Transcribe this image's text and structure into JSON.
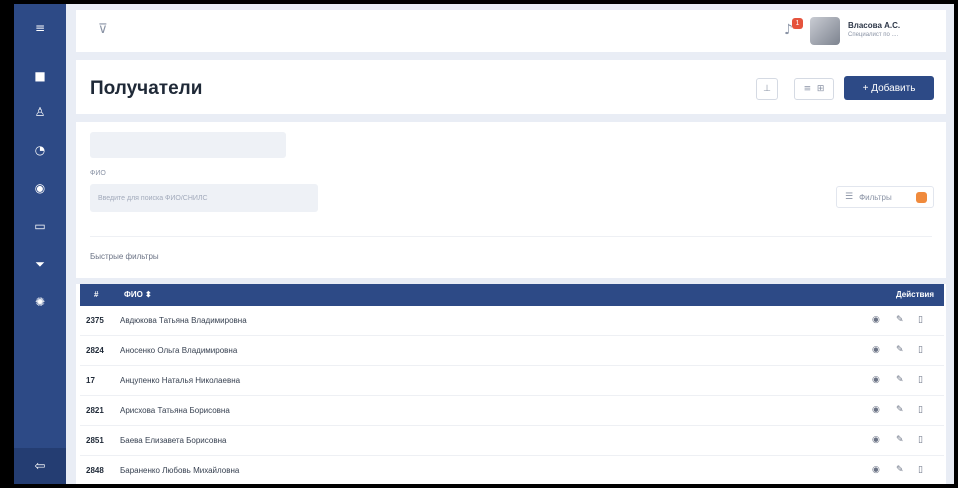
{
  "sidebar": {
    "icons": [
      "menu-icon",
      "dashboard-icon",
      "user-icon",
      "chart-icon",
      "globe-icon",
      "folder-icon",
      "download-icon",
      "settings-icon"
    ],
    "bottom_icon": "logout-icon"
  },
  "topbar": {
    "notification_count": "1",
    "user_name": "Власова А.С.",
    "user_role": "Специалист по ...."
  },
  "header": {
    "title": "Получатели",
    "add_button": "+ Добавить"
  },
  "filters": {
    "fio_label": "ФИО",
    "search_placeholder": "Введите для поиска ФИО/СНИЛС",
    "filters_button": "Фильтры",
    "quick_filters": "Быстрые фильтры"
  },
  "table": {
    "columns": {
      "num": "#",
      "fio": "ФИО ⬍",
      "actions": "Действия"
    },
    "rows": [
      {
        "id": "2375",
        "name": "Авдюкова Татьяна Владимировна"
      },
      {
        "id": "2824",
        "name": "Аносенко Ольга Владимировна"
      },
      {
        "id": "17",
        "name": "Анцупенко Наталья Николаевна"
      },
      {
        "id": "2821",
        "name": "Арисхова Татьяна Борисовна"
      },
      {
        "id": "2851",
        "name": "Баева Елизавета Борисовна"
      },
      {
        "id": "2848",
        "name": "Бараненко Любовь Михайловна"
      }
    ]
  },
  "colors": {
    "primary": "#2d4a86",
    "background": "#e9edf5",
    "accent": "#f08a3c",
    "badge": "#e5533d"
  }
}
